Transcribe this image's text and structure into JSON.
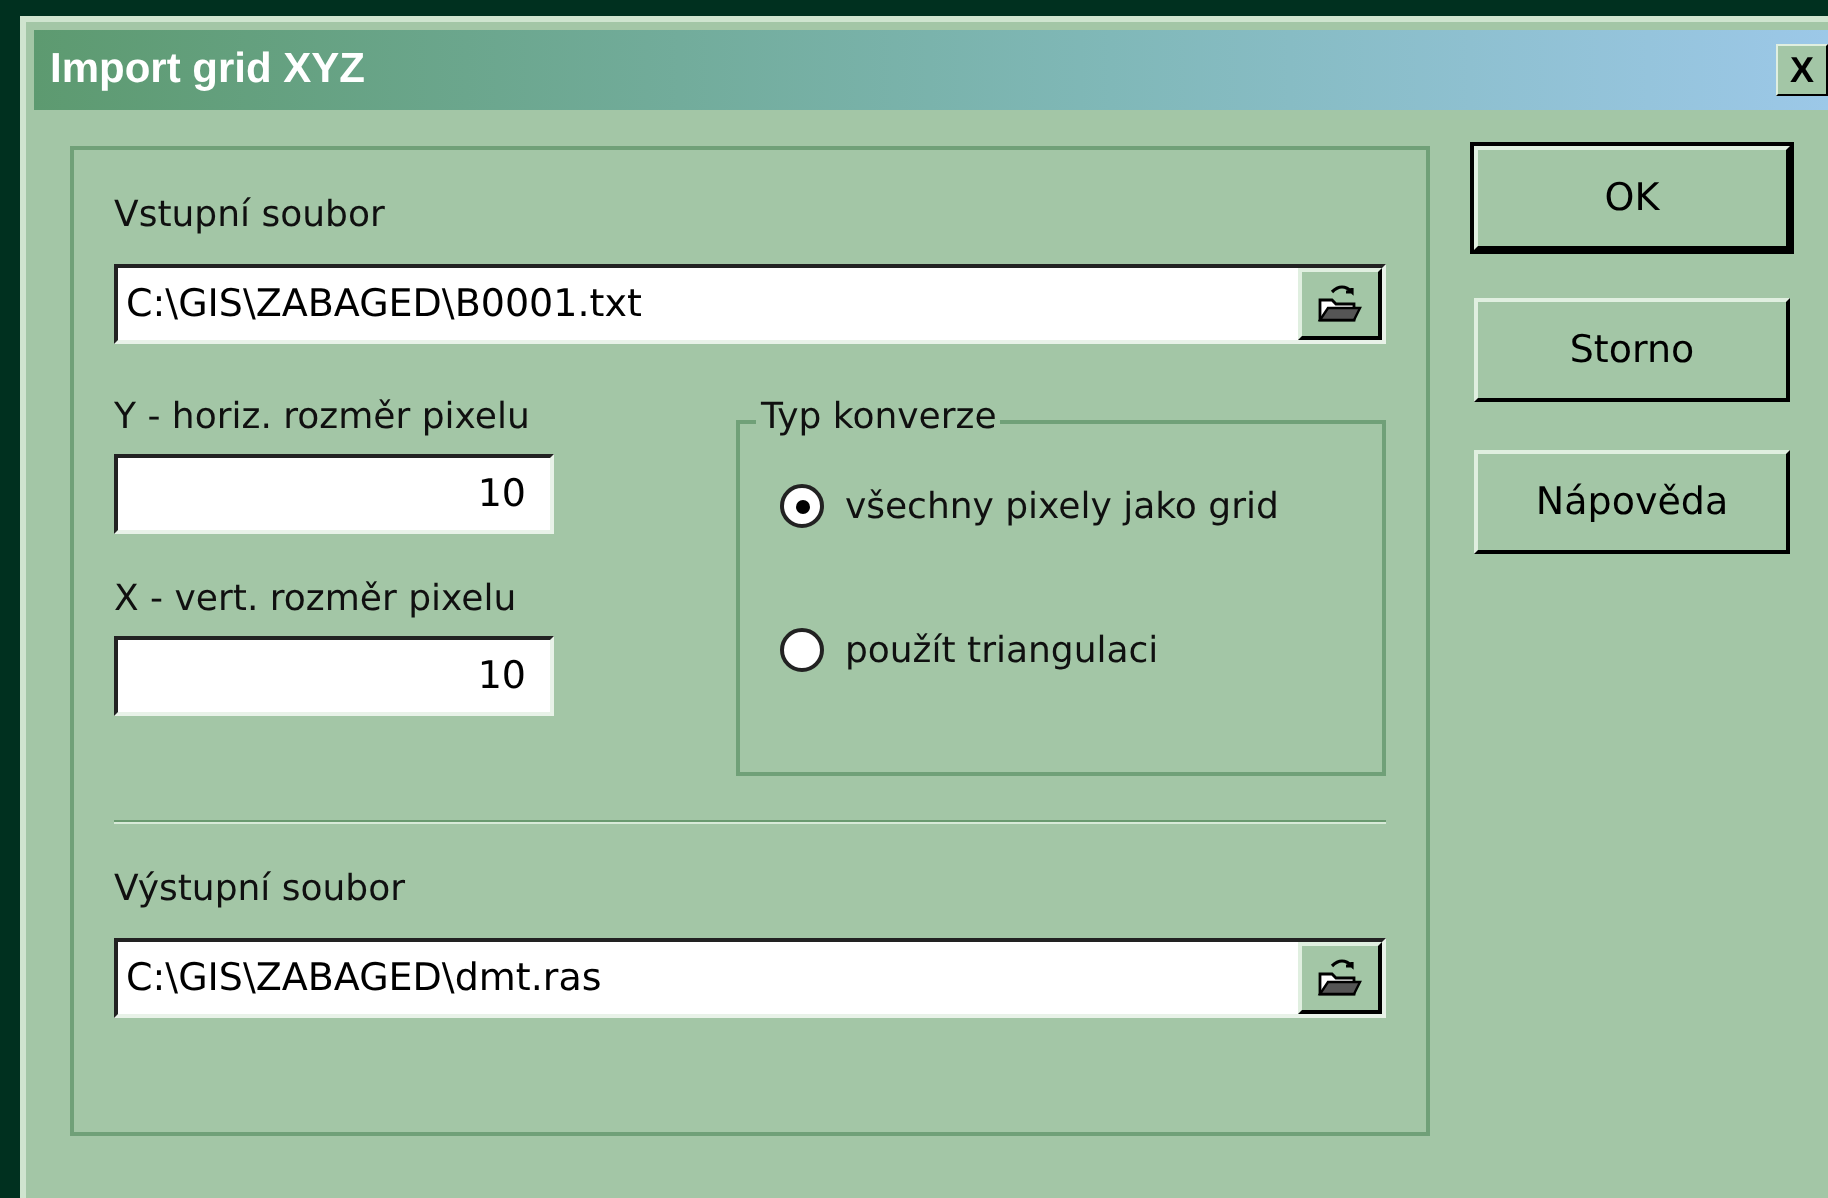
{
  "window": {
    "title": "Import grid XYZ",
    "close": "X"
  },
  "input_file": {
    "label": "Vstupní soubor",
    "value": "C:\\GIS\\ZABAGED\\B0001.txt"
  },
  "pixel_y": {
    "label": "Y - horiz. rozměr pixelu",
    "value": "10"
  },
  "pixel_x": {
    "label": "X - vert. rozměr pixelu",
    "value": "10"
  },
  "conversion": {
    "title": "Typ konverze",
    "options": [
      {
        "label": "všechny pixely jako grid",
        "selected": true
      },
      {
        "label": "použít triangulaci",
        "selected": false
      }
    ]
  },
  "output_file": {
    "label": "Výstupní soubor",
    "value": "C:\\GIS\\ZABAGED\\dmt.ras"
  },
  "buttons": [
    {
      "label": "OK",
      "default": true
    },
    {
      "label": "Storno",
      "default": false
    },
    {
      "label": "Nápověda",
      "default": false
    }
  ]
}
